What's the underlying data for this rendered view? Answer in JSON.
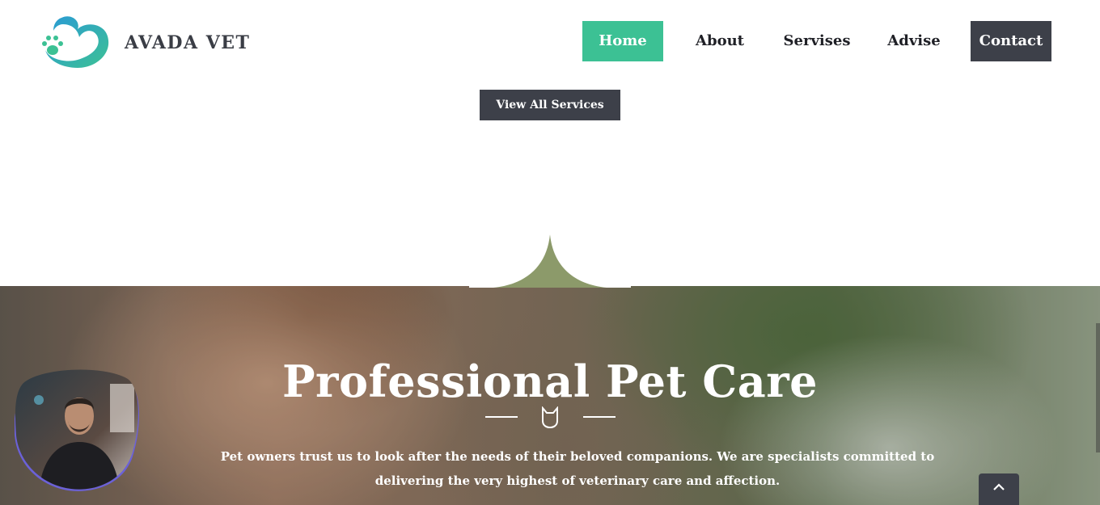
{
  "brand": {
    "name": "AVADA VET",
    "logo_icon": "paw-heart-icon"
  },
  "nav": {
    "home": "Home",
    "about": "About",
    "services": "Servises",
    "advise": "Advise",
    "contact": "Contact"
  },
  "services_section": {
    "view_all_label": "View All Services"
  },
  "hero": {
    "title": "Professional Pet Care",
    "divider_icon": "cat-icon",
    "description": "Pet owners trust us to look after the needs of their beloved companions. We are specialists committed to delivering the very highest of veterinary care and affection."
  },
  "widgets": {
    "back_to_top_icon": "chevron-up-icon",
    "avatar": "person-avatar"
  },
  "colors": {
    "accent": "#3cc194",
    "dark": "#3d4049",
    "text": "#1f2026",
    "avatar_blob": "#6b61d8"
  }
}
